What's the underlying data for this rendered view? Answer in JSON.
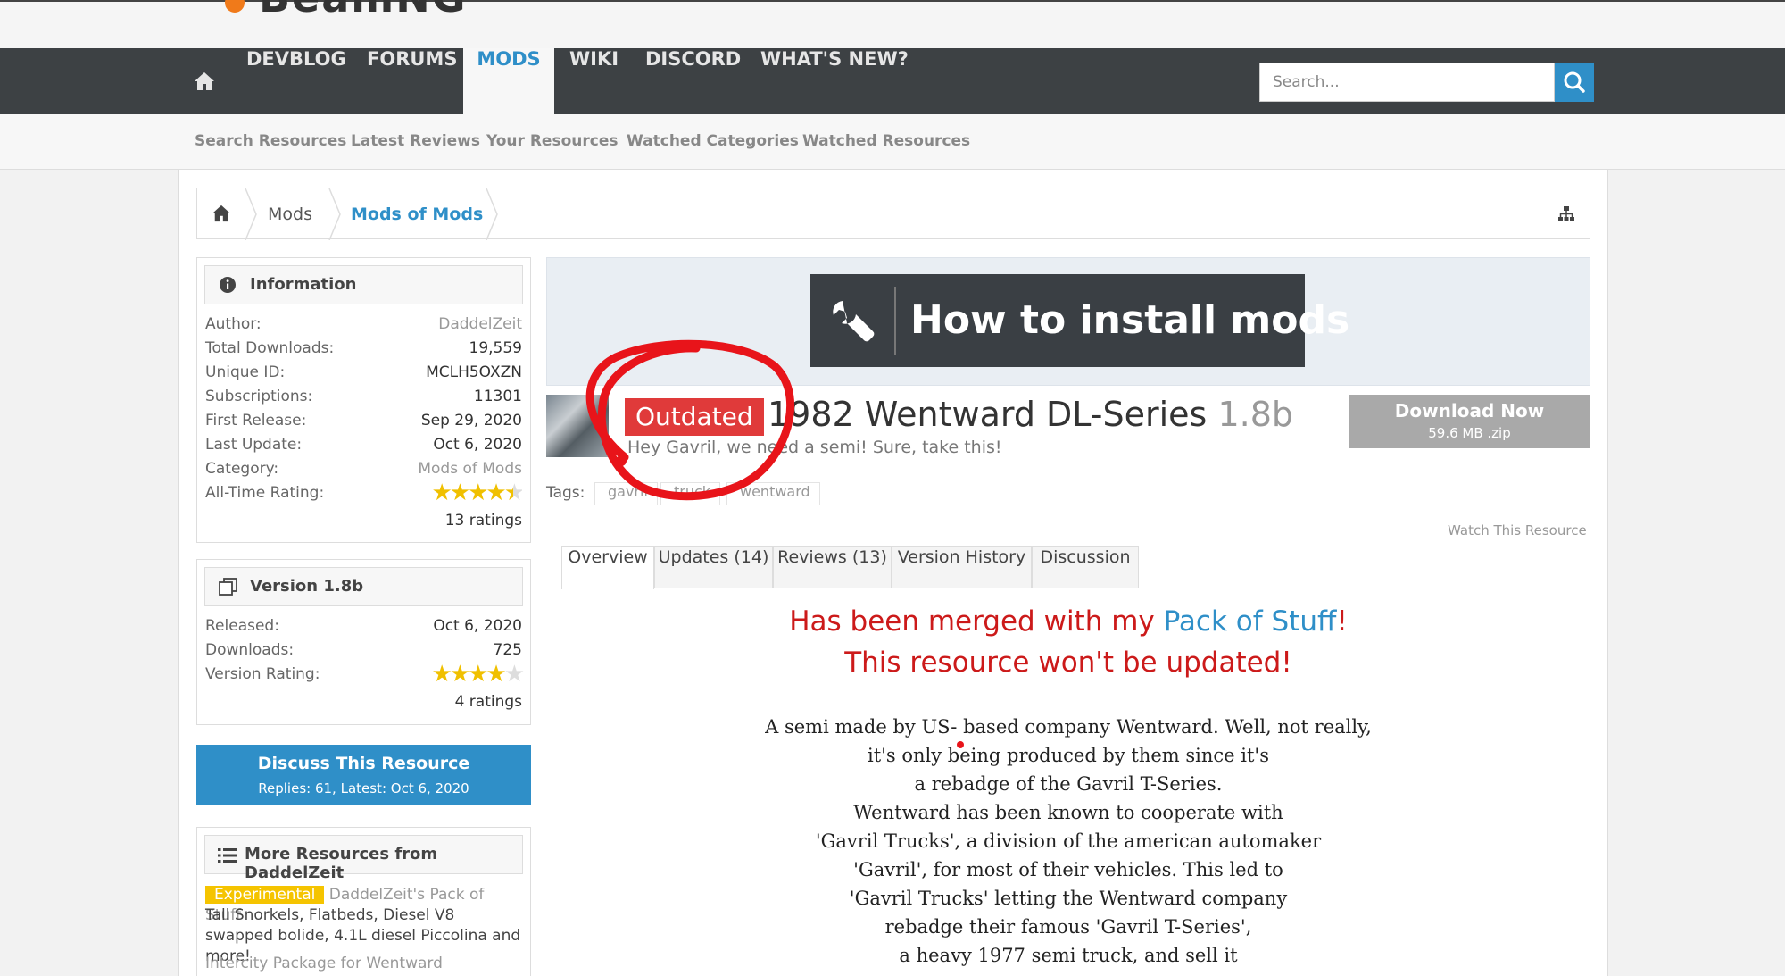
{
  "site": {
    "logo_text": "BeamNG"
  },
  "nav": {
    "items": [
      "DEVBLOG",
      "FORUMS",
      "MODS",
      "WIKI",
      "DISCORD",
      "WHAT'S NEW?"
    ],
    "active": "MODS",
    "search_placeholder": "Search..."
  },
  "subnav": [
    "Search Resources",
    "Latest Reviews",
    "Your Resources",
    "Watched Categories",
    "Watched Resources"
  ],
  "breadcrumb": [
    "Mods",
    "Mods of Mods"
  ],
  "info": {
    "title": "Information",
    "rows": [
      {
        "label": "Author:",
        "value": "DaddelZeit"
      },
      {
        "label": "Total Downloads:",
        "value": "19,559"
      },
      {
        "label": "Unique ID:",
        "value": "MCLH5OXZN"
      },
      {
        "label": "Subscriptions:",
        "value": "11301"
      },
      {
        "label": "First Release:",
        "value": "Sep 29, 2020"
      },
      {
        "label": "Last Update:",
        "value": "Oct 6, 2020"
      },
      {
        "label": "Category:",
        "value": "Mods of Mods"
      },
      {
        "label": "All-Time Rating:",
        "value": ""
      }
    ],
    "rating_stars": 4.5,
    "rating_count": "13 ratings"
  },
  "version": {
    "title": "Version 1.8b",
    "rows": [
      {
        "label": "Released:",
        "value": "Oct 6, 2020"
      },
      {
        "label": "Downloads:",
        "value": "725"
      },
      {
        "label": "Version Rating:",
        "value": ""
      }
    ],
    "rating_stars": 4,
    "rating_count": "4 ratings"
  },
  "discuss": {
    "title": "Discuss This Resource",
    "sub": "Replies: 61, Latest: Oct 6, 2020"
  },
  "more": {
    "title": "More Resources from DaddelZeit",
    "badge": "Experimental",
    "item1_title": "DaddelZeit's Pack of Stuff",
    "item1_desc": "Tall Snorkels, Flatbeds, Diesel V8 swapped bolide, 4.1L diesel Piccolina and more!",
    "item2_title": "Intercity Package for Wentward"
  },
  "banner": {
    "title": "How to install mods"
  },
  "resource": {
    "badge": "Outdated",
    "title": "1982 Wentward DL-Series",
    "version": "1.8b",
    "tagline": "Hey Gavril, we need a semi! Sure, take this!",
    "download_label": "Download Now",
    "download_sub": "59.6 MB .zip",
    "tags_label": "Tags:",
    "tags": [
      "gavril",
      "truck",
      "wentward"
    ],
    "watch": "Watch This Resource"
  },
  "tabs": [
    "Overview",
    "Updates (14)",
    "Reviews (13)",
    "Version History",
    "Discussion"
  ],
  "body": {
    "merged_pre": "Has been merged with my ",
    "merged_link": "Pack of Stuff",
    "merged_post": "!",
    "merged_line2": "This resource won't be updated!",
    "description": [
      "A semi made by US- based company Wentward. Well, not really,",
      "it's only being produced by them since it's",
      "a rebadge of the Gavril T-Series.",
      "Wentward has been known to cooperate with",
      "'Gavril Trucks', a division of the american automaker",
      "'Gavril', for most of their vehicles. This led to",
      "'Gavril Trucks' letting the Wentward company",
      "rebadge their famous 'Gavril T-Series',",
      "a heavy 1977 semi truck, and sell it"
    ]
  },
  "colors": {
    "accent": "#2f8fc8",
    "nav_bg": "#3d4144",
    "outdated": "#e03a3a",
    "merged_text": "#cc1a1a",
    "annotation": "#e8141a"
  }
}
